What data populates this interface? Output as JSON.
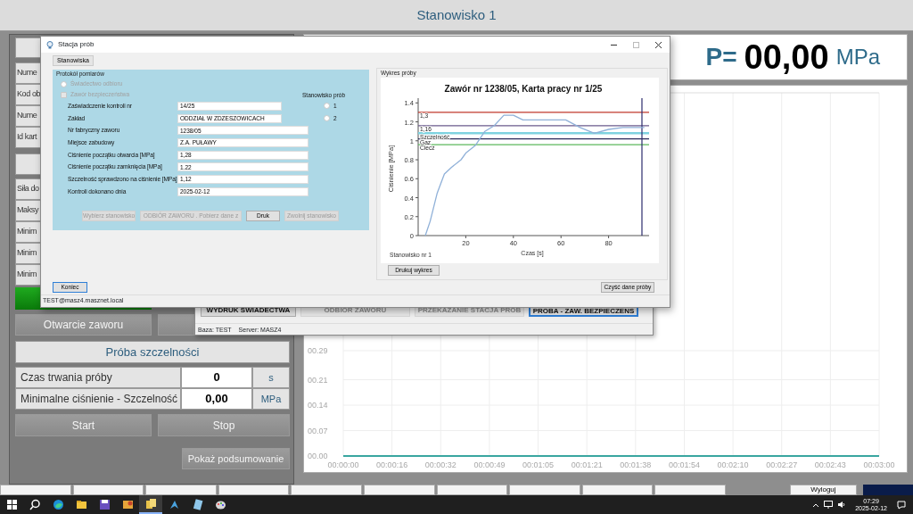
{
  "app_header": {
    "title": "Stanowisko 1"
  },
  "left_panel": {
    "parameter_rows_top": [
      {
        "label": "Nume"
      },
      {
        "label": "Kod ob"
      },
      {
        "label": "Nume"
      },
      {
        "label": "Id kart"
      }
    ],
    "parameter_rows_bottom": [
      {
        "label": "Siła do"
      },
      {
        "label": "Maksy"
      },
      {
        "label": "Minim"
      },
      {
        "label": "Minim"
      },
      {
        "label": "Minim"
      }
    ],
    "valve_indicator": {
      "on": true
    },
    "valve_buttons": [
      {
        "label": "Otwarcie zaworu",
        "disabled": true
      }
    ],
    "tightness_test": {
      "title": "Próba szczelności",
      "rows": [
        {
          "label": "Czas trwania próby",
          "value": "0",
          "unit": "s"
        },
        {
          "label": "Minimalne ciśnienie - Szczelność",
          "value": "0,00",
          "unit": "MPa"
        }
      ],
      "buttons": [
        {
          "label": "Start",
          "disabled": true
        },
        {
          "label": "Stop",
          "disabled": true
        }
      ],
      "summary_button": {
        "label": "Pokaż podsumowanie",
        "disabled": true
      }
    }
  },
  "pressure_display": {
    "prefix": "P=",
    "value": "00,00",
    "unit": "MPa"
  },
  "pressure_chart": {
    "chart_data": {
      "type": "line",
      "categories": [
        "00:00:00",
        "00:00:16",
        "00:00:32",
        "00:00:49",
        "00:01:05",
        "00:01:21",
        "00:01:38",
        "00:01:54",
        "00:02:10",
        "00:02:27",
        "00:02:43",
        "00:03:00"
      ],
      "series": [
        {
          "color": "#3aa6a0",
          "values": [
            0,
            0,
            0,
            0,
            0,
            0,
            0,
            0,
            0,
            0,
            0,
            0
          ]
        }
      ],
      "grid": true,
      "ylim": [
        0,
        1
      ],
      "yticks": [
        {
          "value": 0,
          "label": "00.00"
        },
        {
          "value": 0.07,
          "label": "00.07"
        },
        {
          "value": 0.14,
          "label": "00.14"
        },
        {
          "value": 0.21,
          "label": "00.21"
        },
        {
          "value": 0.29,
          "label": "00.29"
        }
      ]
    }
  },
  "bottom_bar": {
    "logout_label": "Wyloguj"
  },
  "secondary_window": {
    "buttons": [
      {
        "label": "WYDRUK SWIADECTWA",
        "disabled": false,
        "selected": false
      },
      {
        "label": "ODBIOR ZAWORU",
        "disabled": true,
        "selected": false
      },
      {
        "label": "PRZEKAZANIE STACJA PROB",
        "disabled": true,
        "selected": false
      },
      {
        "label": "PROBA - ZAW. BEZPIECZENS",
        "disabled": false,
        "selected": true
      }
    ],
    "status": [
      "Baza: TEST",
      "Server: MASZ4"
    ]
  },
  "dialog": {
    "title": "Stacja prób",
    "menu": [
      "Stanowiska"
    ],
    "protocol": {
      "legend": "Protokół pomiarów",
      "options": [
        {
          "kind": "radio",
          "label": "Świadectwo odbioru",
          "checked": false,
          "disabled": true
        },
        {
          "kind": "checkbox",
          "label": "Zawór bezpieczeństwa",
          "checked": false,
          "disabled": true
        }
      ],
      "fields": [
        {
          "label": "Zaświadczenie kontroli nr",
          "value": "14/25"
        },
        {
          "label": "Zakład",
          "value": "ODDZIAŁ W ZDZESZOWICACH"
        },
        {
          "label": "Nr fabryczny zaworu",
          "value": "1238/05"
        },
        {
          "label": "Miejsce zabudowy",
          "value": "Z.A. PUŁAWY"
        },
        {
          "label": "Ciśnienie początku otwarcia [MPa]",
          "value": "1,28"
        },
        {
          "label": "Ciśnienie początku zamknięcia [MPa]",
          "value": "1.22"
        },
        {
          "label": "Szczelność sprawdzono na ciśnienie [MPa]",
          "value": "1,12"
        },
        {
          "label": "Kontroli dokonano dnia",
          "value": "2025-02-12"
        }
      ],
      "station": {
        "title": "Stanowisko prób",
        "options": [
          {
            "label": "1",
            "selected": false
          },
          {
            "label": "2",
            "selected": false
          }
        ]
      },
      "buttons": [
        {
          "label": "Wybierz stanowisko",
          "disabled": true
        },
        {
          "label": "ODBIÓR ZAWORU . Pobierz dane z",
          "disabled": true
        },
        {
          "label": "Druk",
          "disabled": false
        },
        {
          "label": "Zwolnij stanowisko",
          "disabled": true
        }
      ]
    },
    "chart_group": {
      "legend": "Wykres próby",
      "chart_data": {
        "type": "line",
        "title": "Zawór nr 1238/05, Karta pracy nr 1/25",
        "xlabel": "Czas [s]",
        "ylabel": "Ciśnienie [MPa]",
        "x": [
          3,
          5,
          8,
          11,
          14,
          18,
          20,
          24,
          28,
          32,
          36,
          40,
          44,
          50,
          62,
          68,
          74,
          80,
          86,
          95
        ],
        "series": [
          {
            "color": "#8fb0d8",
            "values": [
              0,
              0.15,
              0.45,
              0.65,
              0.72,
              0.8,
              0.87,
              0.95,
              1.1,
              1.16,
              1.27,
              1.27,
              1.22,
              1.22,
              1.22,
              1.14,
              1.08,
              1.12,
              1.14,
              1.14
            ]
          }
        ],
        "xlim": [
          0,
          97
        ],
        "ylim": [
          0,
          1.45
        ],
        "xticks": [
          20,
          40,
          60,
          80
        ],
        "yticks": [
          0,
          0.2,
          0.4,
          0.6,
          0.8,
          1,
          1.2,
          1.4
        ],
        "ref_lines": [
          {
            "axis": "y",
            "value": 1.3,
            "label": "1,3",
            "color": "#c0392b"
          },
          {
            "axis": "y",
            "value": 1.16,
            "label": "1,16",
            "color": "#6a5a8c"
          },
          {
            "axis": "y",
            "value": 1.08,
            "label": "Szczelność",
            "color": "#7fd3e0"
          },
          {
            "axis": "y",
            "value": 1.02,
            "label": "Gaz",
            "color": "#2a2a5a"
          },
          {
            "axis": "y",
            "value": 0.96,
            "label": "Ciecz",
            "color": "#5cb85c"
          },
          {
            "axis": "x",
            "value": 94,
            "color": "#2c2c6c"
          }
        ]
      },
      "caption": "Stanowisko nr 1",
      "print_button": "Drukuj wykres"
    },
    "clear_button": "Czyść dane próby",
    "close_button": "Koniec",
    "status": "TEST@masz4.masznet.local"
  },
  "taskbar": {
    "time": "07:29",
    "date": "2025-02-12"
  }
}
